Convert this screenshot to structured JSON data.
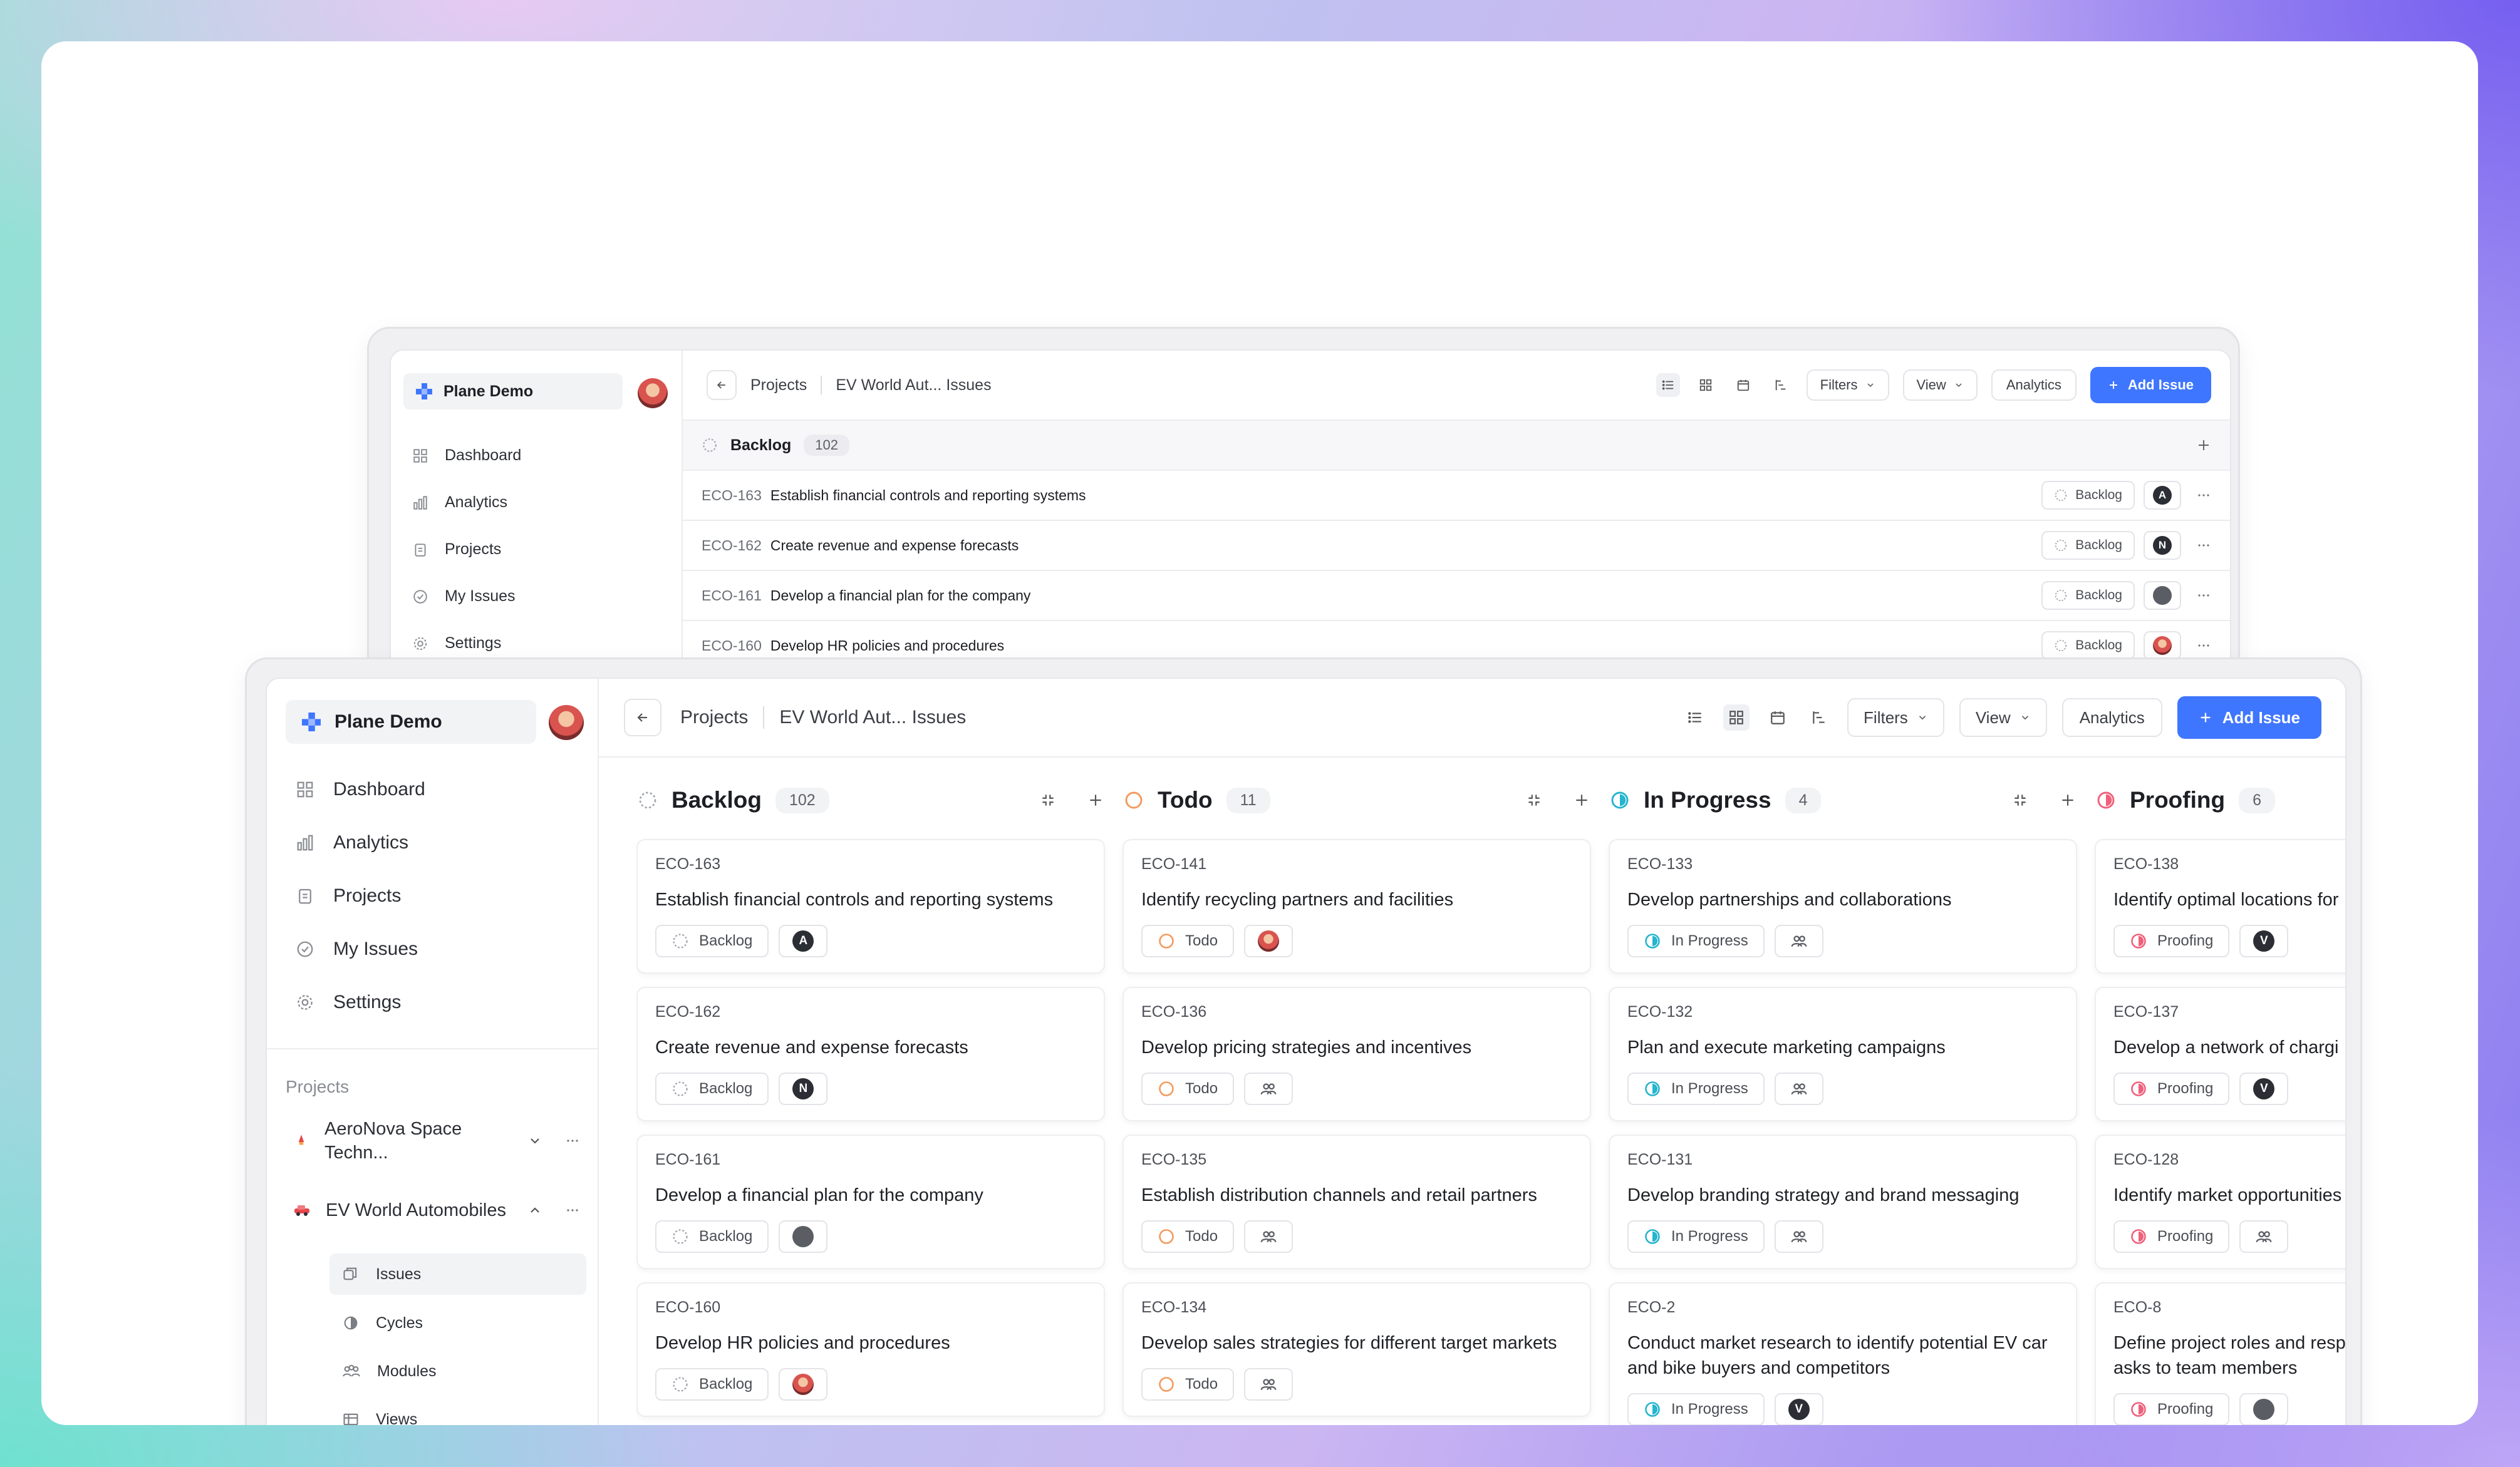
{
  "workspace": {
    "name": "Plane Demo"
  },
  "nav": [
    {
      "label": "Dashboard",
      "icon": "grid-icon"
    },
    {
      "label": "Analytics",
      "icon": "bar-chart-icon"
    },
    {
      "label": "Projects",
      "icon": "clipboard-icon"
    },
    {
      "label": "My Issues",
      "icon": "check-circle-icon"
    },
    {
      "label": "Settings",
      "icon": "gear-icon"
    }
  ],
  "sidebar": {
    "projects_title": "Projects",
    "projects": [
      {
        "name": "AeroNova Space Techn...",
        "line1": "AeroNova Space",
        "line2": "Techn..."
      },
      {
        "name": "EV World Automobiles"
      }
    ],
    "subitems": [
      {
        "label": "Issues",
        "icon": "layers-icon"
      },
      {
        "label": "Cycles",
        "icon": "contrast-icon"
      },
      {
        "label": "Modules",
        "icon": "team-icon"
      },
      {
        "label": "Views",
        "icon": "table-icon"
      }
    ]
  },
  "breadcrumb": {
    "root": "Projects",
    "current": "EV World Aut... Issues"
  },
  "toolbar": {
    "filters": "Filters",
    "view": "View",
    "analytics": "Analytics",
    "add_issue": "Add Issue"
  },
  "list_view": {
    "group": {
      "name": "Backlog",
      "count": "102"
    },
    "rows": [
      {
        "id": "ECO-163",
        "title": "Establish financial controls and reporting systems",
        "state": "Backlog",
        "assignee": "A"
      },
      {
        "id": "ECO-162",
        "title": "Create revenue and expense forecasts",
        "state": "Backlog",
        "assignee": "N"
      },
      {
        "id": "ECO-161",
        "title": "Develop a financial plan for the company",
        "state": "Backlog",
        "assignee": ""
      },
      {
        "id": "ECO-160",
        "title": "Develop HR policies and procedures",
        "state": "Backlog",
        "assignee": ""
      }
    ]
  },
  "kanban": {
    "columns": [
      {
        "name": "Backlog",
        "count": "102",
        "state_color": "#a3a6ad",
        "cards": [
          {
            "id": "ECO-163",
            "title": "Establish financial controls and reporting systems",
            "state": "Backlog",
            "assignee": "A"
          },
          {
            "id": "ECO-162",
            "title": "Create revenue and expense forecasts",
            "state": "Backlog",
            "assignee": "N"
          },
          {
            "id": "ECO-161",
            "title": "Develop a financial plan for the company",
            "state": "Backlog",
            "assignee": ""
          },
          {
            "id": "ECO-160",
            "title": "Develop HR policies and procedures",
            "state": "Backlog",
            "assignee": ""
          }
        ]
      },
      {
        "name": "Todo",
        "count": "11",
        "state_color": "#f39a5c",
        "cards": [
          {
            "id": "ECO-141",
            "title": "Identify recycling partners and facilities",
            "state": "Todo",
            "assignee": ""
          },
          {
            "id": "ECO-136",
            "title": "Develop pricing strategies and incentives",
            "state": "Todo",
            "assignee": ""
          },
          {
            "id": "ECO-135",
            "title": "Establish distribution channels and retail partners",
            "state": "Todo",
            "assignee": ""
          },
          {
            "id": "ECO-134",
            "title": "Develop sales strategies for different target markets",
            "state": "Todo",
            "assignee": ""
          }
        ]
      },
      {
        "name": "In Progress",
        "count": "4",
        "state_color": "#26b5ce",
        "cards": [
          {
            "id": "ECO-133",
            "title": "Develop partnerships and collaborations",
            "state": "In Progress",
            "assignee": ""
          },
          {
            "id": "ECO-132",
            "title": "Plan and execute marketing campaigns",
            "state": "In Progress",
            "assignee": ""
          },
          {
            "id": "ECO-131",
            "title": "Develop branding strategy and brand messaging",
            "state": "In Progress",
            "assignee": ""
          },
          {
            "id": "ECO-2",
            "title": "Conduct market research to identify potential EV car and bike buyers and competitors",
            "line1": "Conduct market research to identify potential EV car",
            "line2": "and bike buyers and competitors",
            "state": "In Progress",
            "assignee": "V"
          }
        ]
      },
      {
        "name": "Proofing",
        "count": "6",
        "state_color": "#f0607a",
        "cards": [
          {
            "id": "ECO-138",
            "title": "Identify optimal locations for",
            "state": "Proofing",
            "assignee": "V"
          },
          {
            "id": "ECO-137",
            "title": "Develop a network of chargi",
            "state": "Proofing",
            "assignee": "V"
          },
          {
            "id": "ECO-128",
            "title": "Identify market opportunities",
            "state": "Proofing",
            "assignee": ""
          },
          {
            "id": "ECO-8",
            "title": "Define project roles and resp",
            "line1": "Define project roles and resp",
            "line2": "asks to team members",
            "state": "Proofing",
            "assignee": ""
          }
        ]
      }
    ]
  },
  "colors": {
    "accent": "#3f76ff",
    "backlog": "#a3a6ad",
    "todo": "#f39a5c",
    "in_progress": "#26b5ce",
    "proofing": "#f0607a"
  }
}
